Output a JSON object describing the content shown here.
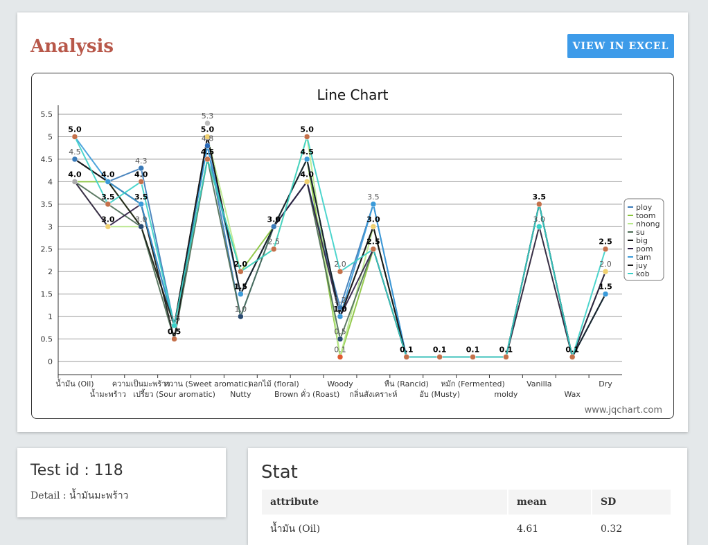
{
  "page": {
    "title": "Analysis",
    "excel_button": "VIEW IN EXCEL",
    "watermark": "www.jqchart.com"
  },
  "test": {
    "id_text": "Test id : 118",
    "detail_text": "Detail : น้ำมันมะพร้าว"
  },
  "stat": {
    "title": "Stat",
    "columns": [
      "attribute",
      "mean",
      "SD"
    ],
    "rows": [
      [
        "น้ำมัน (Oil)",
        "4.61",
        "0.32"
      ]
    ]
  },
  "chart_data": {
    "type": "line",
    "title": "Line Chart",
    "ylim": [
      0,
      5.5
    ],
    "yticks": [
      "0",
      "0.5",
      "1",
      "1.5",
      "2",
      "2.5",
      "3",
      "3.5",
      "4",
      "4.5",
      "5",
      "5.5"
    ],
    "categories": [
      "น้ำมัน (Oil)",
      "น้ำมะพร้าว",
      "ความเป็นมะพร้าว",
      "เปรี้ยว (Sour aromatic)",
      "หวาน (Sweet aromatic)",
      "Nutty",
      "ดอกไม้ (floral)",
      "Brown คั่ว (Roast)",
      "Woody",
      "กลิ่นสังเคราะห์",
      "หืน (Rancid)",
      "อับ (Musty)",
      "หมัก (Fermented)",
      "moldy",
      "Vanilla",
      "Wax",
      "Dry"
    ],
    "grid": true,
    "legend_position": "right",
    "series": [
      {
        "name": "ploy",
        "color": "#3a7ab8",
        "values": [
          4.5,
          4.0,
          4.3,
          0.8,
          4.8,
          1.0,
          3.0,
          4.0,
          1.2,
          3.5,
          0.1,
          0.1,
          0.1,
          0.1,
          3.5,
          0.1,
          1.5
        ]
      },
      {
        "name": "toom",
        "color": "#88c43a",
        "values": [
          4.0,
          4.0,
          3.0,
          0.8,
          4.5,
          2.0,
          3.0,
          4.5,
          0.1,
          2.5,
          0.1,
          0.1,
          0.1,
          0.1,
          3.5,
          0.1,
          2.0
        ]
      },
      {
        "name": "nhong",
        "color": "#b8e98a",
        "values": [
          4.0,
          3.0,
          3.0,
          0.8,
          5.0,
          2.0,
          2.5,
          5.0,
          0.1,
          3.0,
          0.1,
          0.1,
          0.1,
          0.1,
          3.0,
          0.1,
          2.0
        ]
      },
      {
        "name": "su",
        "color": "#4a6a52",
        "values": [
          4.0,
          3.5,
          3.0,
          0.5,
          4.5,
          1.0,
          3.0,
          4.0,
          0.5,
          2.5,
          0.1,
          0.1,
          0.1,
          0.1,
          3.5,
          0.1,
          2.0
        ]
      },
      {
        "name": "big",
        "color": "#111111",
        "values": [
          4.5,
          4.0,
          3.5,
          0.5,
          5.0,
          1.5,
          3.0,
          4.5,
          1.0,
          3.0,
          0.1,
          0.1,
          0.1,
          0.1,
          3.5,
          0.1,
          1.5
        ]
      },
      {
        "name": "pom",
        "color": "#2a1a40",
        "values": [
          4.0,
          3.0,
          3.5,
          0.8,
          5.0,
          1.5,
          3.0,
          4.0,
          1.0,
          2.5,
          0.1,
          0.1,
          0.1,
          0.1,
          3.0,
          0.1,
          2.0
        ]
      },
      {
        "name": "tam",
        "color": "#3a9ad9",
        "values": [
          5.0,
          4.0,
          3.5,
          0.8,
          4.8,
          1.5,
          3.0,
          4.5,
          1.0,
          3.5,
          0.1,
          0.1,
          0.1,
          0.1,
          3.5,
          0.1,
          1.5
        ]
      },
      {
        "name": "juy",
        "color": "#1a1a1a",
        "values": [
          4.5,
          4.0,
          3.0,
          0.8,
          5.0,
          1.5,
          3.0,
          4.5,
          1.0,
          3.0,
          0.1,
          0.1,
          0.1,
          0.1,
          3.5,
          0.1,
          1.5
        ]
      },
      {
        "name": "kob",
        "color": "#3ad0c8",
        "values": [
          5.0,
          3.5,
          4.0,
          0.8,
          4.5,
          2.0,
          2.5,
          5.0,
          2.0,
          2.5,
          0.1,
          0.1,
          0.1,
          0.1,
          3.5,
          0.1,
          2.5
        ]
      }
    ],
    "markers": [
      [
        {
          "v": 5.0,
          "c": "#c4704a",
          "l": "5.0",
          "b": true
        },
        {
          "v": 4.5,
          "c": "#3a7ab8",
          "l": "4.5"
        },
        {
          "v": 4.0,
          "c": "#aaaaaa",
          "l": "4.0",
          "b": true
        }
      ],
      [
        {
          "v": 4.0,
          "c": "#3a9ad9",
          "l": "4.0",
          "b": true
        },
        {
          "v": 3.5,
          "c": "#c4704a",
          "l": "3.5",
          "b": true
        },
        {
          "v": 3.0,
          "c": "#f0d070",
          "l": "3.0",
          "b": true
        }
      ],
      [
        {
          "v": 4.3,
          "c": "#3a7ab8",
          "l": "4.3"
        },
        {
          "v": 4.0,
          "c": "#c4704a",
          "l": "4.0",
          "b": true
        },
        {
          "v": 3.5,
          "c": "#3a9ad9",
          "l": "3.5",
          "b": true
        },
        {
          "v": 3.0,
          "c": "#2a4a70",
          "l": "3.0"
        }
      ],
      [
        {
          "v": 0.8,
          "c": "#3ad0c8",
          "l": "0.8"
        },
        {
          "v": 0.5,
          "c": "#c4704a",
          "l": "0.5",
          "b": true
        }
      ],
      [
        {
          "v": 5.3,
          "c": "#bbbbbb",
          "l": "5.3"
        },
        {
          "v": 5.0,
          "c": "#f0d070",
          "l": "5.0",
          "b": true
        },
        {
          "v": 4.8,
          "c": "#2a6ab8",
          "l": "4.8"
        },
        {
          "v": 4.5,
          "c": "#c4704a",
          "l": "4.5",
          "b": true
        }
      ],
      [
        {
          "v": 2.0,
          "c": "#c4704a",
          "l": "2.0",
          "b": true
        },
        {
          "v": 1.5,
          "c": "#3a9ad9",
          "l": "1.5",
          "b": true
        },
        {
          "v": 1.0,
          "c": "#2a4a70",
          "l": "1.0"
        }
      ],
      [
        {
          "v": 3.0,
          "c": "#3a7ab8",
          "l": "3.0",
          "b": true
        },
        {
          "v": 2.5,
          "c": "#c4704a",
          "l": "2.5"
        }
      ],
      [
        {
          "v": 5.0,
          "c": "#c4704a",
          "l": "5.0",
          "b": true
        },
        {
          "v": 4.5,
          "c": "#3a9ad9",
          "l": "4.5",
          "b": true
        },
        {
          "v": 4.0,
          "c": "#f0d070",
          "l": "4.0",
          "b": true
        }
      ],
      [
        {
          "v": 2.0,
          "c": "#c4704a",
          "l": "2.0"
        },
        {
          "v": 1.2,
          "c": "#3a7ab8",
          "l": "1.2"
        },
        {
          "v": 1.0,
          "c": "#3a9ad9",
          "l": "1.0",
          "b": true
        },
        {
          "v": 0.5,
          "c": "#2a4a70",
          "l": "0.5"
        },
        {
          "v": 0.1,
          "c": "#e05a30",
          "l": "0.1"
        }
      ],
      [
        {
          "v": 3.5,
          "c": "#3a9ad9",
          "l": "3.5"
        },
        {
          "v": 3.0,
          "c": "#f0d070",
          "l": "3.0",
          "b": true
        },
        {
          "v": 2.5,
          "c": "#c4704a",
          "l": "2.5",
          "b": true
        }
      ],
      [
        {
          "v": 0.1,
          "c": "#c4704a",
          "l": "0.1",
          "b": true
        }
      ],
      [
        {
          "v": 0.1,
          "c": "#c4704a",
          "l": "0.1",
          "b": true
        }
      ],
      [
        {
          "v": 0.1,
          "c": "#c4704a",
          "l": "0.1",
          "b": true
        }
      ],
      [
        {
          "v": 0.1,
          "c": "#c4704a",
          "l": "0.1",
          "b": true
        }
      ],
      [
        {
          "v": 3.5,
          "c": "#c4704a",
          "l": "3.5",
          "b": true
        },
        {
          "v": 3.0,
          "c": "#3ad0c8",
          "l": "3.0"
        }
      ],
      [
        {
          "v": 0.1,
          "c": "#c4704a",
          "l": "0.1",
          "b": true
        }
      ],
      [
        {
          "v": 2.5,
          "c": "#c4704a",
          "l": "2.5",
          "b": true
        },
        {
          "v": 2.0,
          "c": "#f0d070",
          "l": "2.0"
        },
        {
          "v": 1.5,
          "c": "#3a9ad9",
          "l": "1.5",
          "b": true
        }
      ]
    ]
  }
}
